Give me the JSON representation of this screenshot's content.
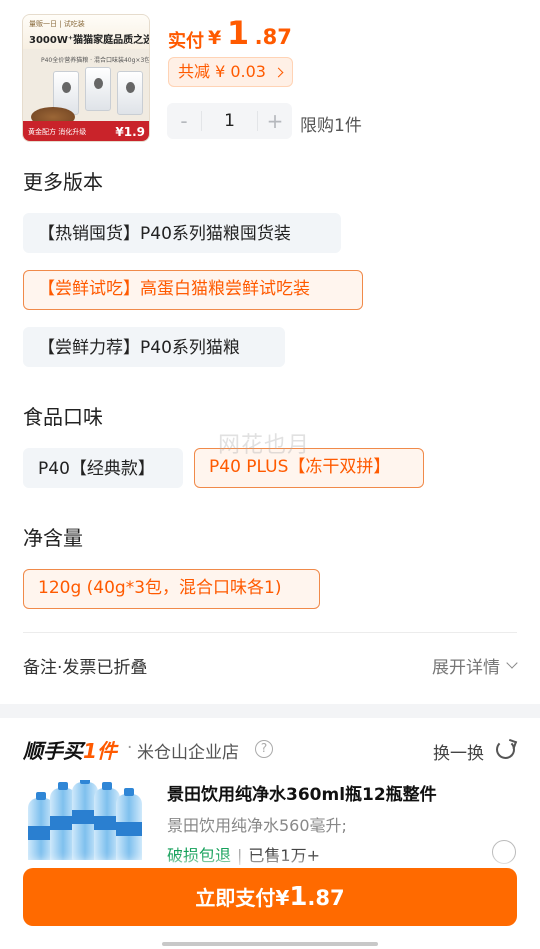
{
  "product": {
    "image": {
      "top_tag": "量贩一日 | 试吃装",
      "headline": "3000W⁺猫猫家庭品质之选",
      "subline": "P40全价营养猫粮 · 混合口味装40g×3包",
      "footer_text": "黄金配方 消化升级",
      "footer_price": "¥1.9"
    },
    "pay_label": "实付",
    "currency": "¥",
    "price_int": "1",
    "price_dec": ".87",
    "saving_text": "共减 ¥ 0.03",
    "stepper": {
      "minus": "-",
      "value": "1",
      "plus": "+"
    },
    "limit_text": "限购1件"
  },
  "versions": {
    "title": "更多版本",
    "options": [
      {
        "label": "【热销囤货】P40系列猫粮囤货装",
        "selected": false
      },
      {
        "label": "【尝鲜试吃】高蛋白猫粮尝鲜试吃装",
        "selected": true
      },
      {
        "label": "【尝鲜力荐】P40系列猫粮",
        "selected": false
      }
    ]
  },
  "flavor": {
    "title": "食品口味",
    "options": [
      {
        "label": "P40【经典款】",
        "selected": false
      },
      {
        "label": "P40 PLUS【冻干双拼】",
        "selected": true
      }
    ]
  },
  "weight": {
    "title": "净含量",
    "options": [
      {
        "label": "120g (40g*3包，混合口味各1)",
        "selected": true
      }
    ]
  },
  "remark": {
    "label": "备注·发票已折叠",
    "expand_label": "展开详情"
  },
  "add_on": {
    "title_prefix": "顺手买",
    "title_accent": "1件",
    "dot": "·",
    "store": "米仓山企业店",
    "help": "?",
    "swap_label": "换一换",
    "item": {
      "name": "景田饮用纯净水360ml瓶12瓶整件",
      "desc": "景田饮用纯净水560毫升;",
      "tag": "破损包退",
      "sold": "已售1万+"
    }
  },
  "pay_button": {
    "label": "立即支付¥",
    "int": "1",
    "dec": ".87"
  },
  "watermark": "网花也月",
  "colors": {
    "accent": "#ff5a00",
    "button": "#ff6a00",
    "green": "#14a05a"
  }
}
